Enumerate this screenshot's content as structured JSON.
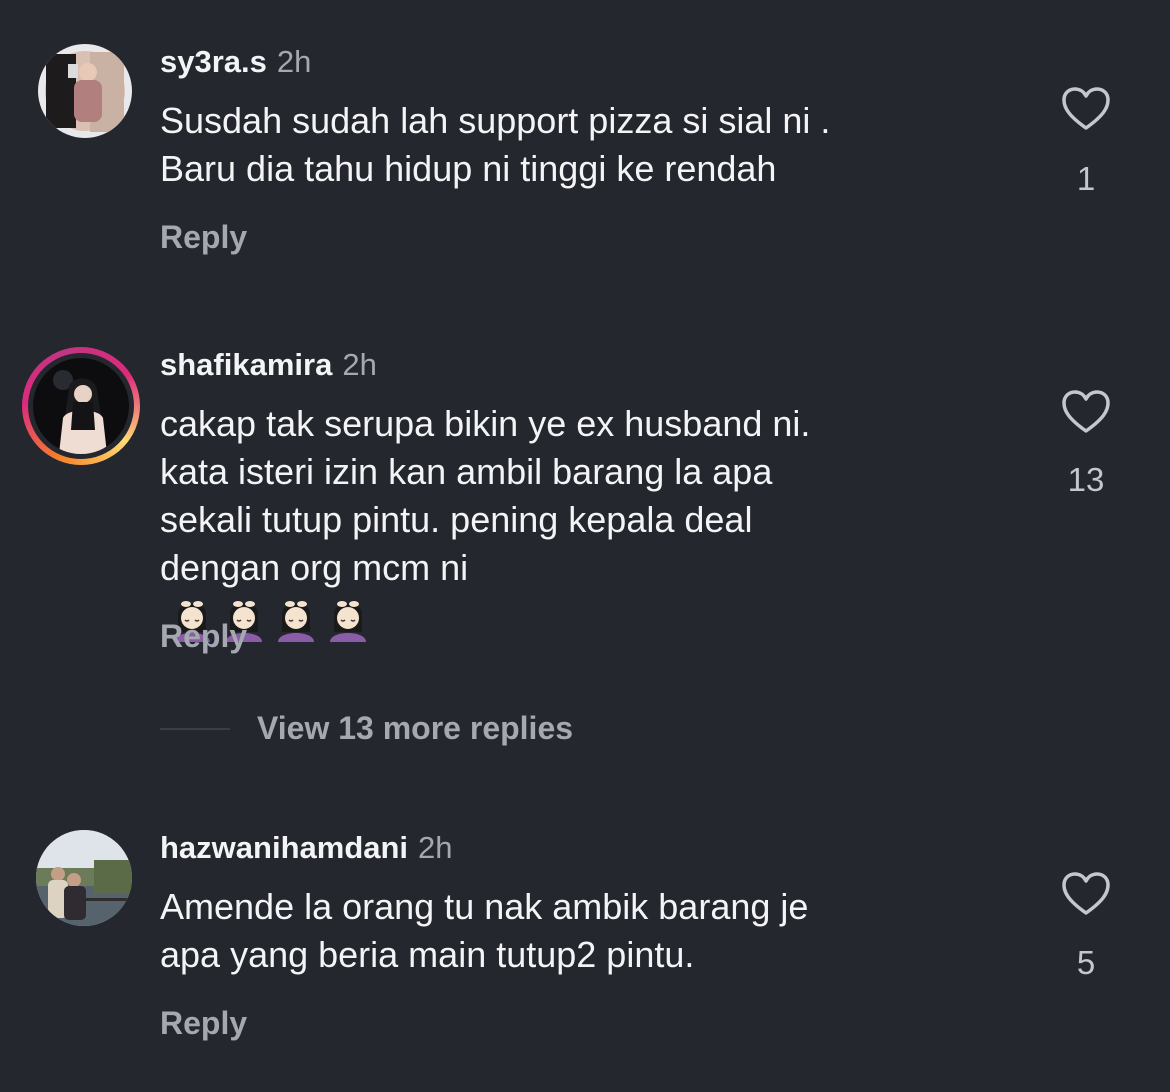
{
  "comments": [
    {
      "username": "sy3ra.s",
      "time": "2h",
      "lines": [
        "Susdah sudah lah support pizza si sial ni .",
        "Baru dia tahu hidup ni tinggi ke rendah"
      ],
      "reply_label": "Reply",
      "likes": "1",
      "has_story": false,
      "like_icon": "heart-outline-icon"
    },
    {
      "username": "shafikamira",
      "time": "2h",
      "lines": [
        "cakap tak serupa bikin ye ex husband ni.",
        "kata isteri izin kan ambil barang la apa",
        "sekali tutup pintu.  pening kepala deal",
        "dengan org mcm ni"
      ],
      "emoji": "face-massage-emoji",
      "emoji_count": 4,
      "reply_label": "Reply",
      "likes": "13",
      "has_story": true,
      "like_icon": "heart-outline-icon"
    },
    {
      "username": "hazwanihamdani",
      "time": "2h",
      "lines": [
        "Amende la orang tu nak ambik barang je",
        "apa yang beria main tutup2 pintu."
      ],
      "reply_label": "Reply",
      "likes": "5",
      "has_story": false,
      "like_icon": "heart-outline-icon"
    }
  ],
  "view_more_label": "View 13 more replies",
  "colors": {
    "background": "#25272e",
    "primary_text": "#f3f4f6",
    "secondary_text": "#a5a8b0",
    "story_ring_start": "#f58529",
    "story_ring_end": "#dd2a7b"
  }
}
